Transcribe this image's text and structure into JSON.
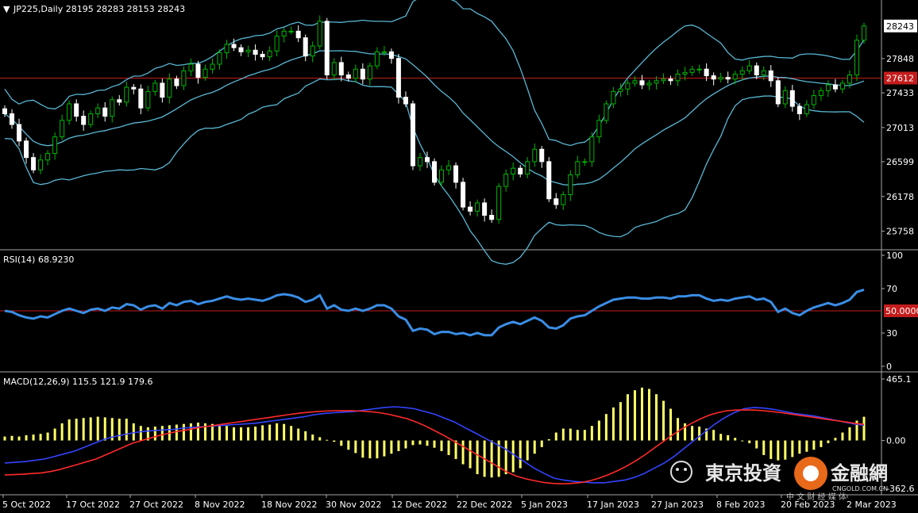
{
  "panels": {
    "main": {
      "header": "JP225,Daily  28195 28283 28153 28243",
      "current_price_label": "28243",
      "red_line_label": "27612",
      "axis_ticks": [
        "27848",
        "27433",
        "27013",
        "26599",
        "26178",
        "25758"
      ]
    },
    "rsi": {
      "header": "RSI(14) 68.9230",
      "axis_ticks": [
        "100",
        "70",
        "50.0000",
        "30",
        "0"
      ]
    },
    "macd": {
      "header": "MACD(12,26,9) 115.5 121.9 179.6",
      "axis_ticks": [
        "465.1",
        "0.00",
        "-362.6"
      ]
    },
    "x_labels": [
      "5 Oct 2022",
      "17 Oct 2022",
      "27 Oct 2022",
      "8 Nov 2022",
      "18 Nov 2022",
      "30 Nov 2022",
      "12 Dec 2022",
      "22 Dec 2022",
      "5 Jan 2023",
      "17 Jan 2023",
      "27 Jan 2023",
      "8 Feb 2023",
      "20 Feb 2023",
      "2 Mar 2023"
    ]
  },
  "watermark": {
    "text": "東京投資",
    "text2": "金融網",
    "small": "CNGOLD.COM.CN",
    "sub": "中 文 财 经 媒 体"
  },
  "colors": {
    "bull": "#00b800",
    "bear": "#ffffff",
    "bands": "#59b7d4",
    "rsi": "#3a8ee6",
    "macd_hist": "#ffff66",
    "macd_line": "#3344ff",
    "signal_line": "#ff2a2a",
    "ref_line": "#c41c1c"
  },
  "chart_data": {
    "type": "candlestick",
    "close": [
      27180,
      27050,
      26850,
      26650,
      26500,
      26620,
      26700,
      26900,
      27100,
      27300,
      27150,
      27050,
      27180,
      27250,
      27150,
      27350,
      27320,
      27500,
      27480,
      27250,
      27450,
      27550,
      27380,
      27600,
      27520,
      27700,
      27780,
      27620,
      27720,
      27780,
      27920,
      28020,
      27980,
      27930,
      27950,
      27900,
      27870,
      27940,
      28120,
      28180,
      28180,
      28100,
      27880,
      28000,
      28300,
      27650,
      27800,
      27650,
      27610,
      27720,
      27600,
      27760,
      27930,
      27930,
      27850,
      27380,
      27300,
      26550,
      26650,
      26600,
      26350,
      26500,
      26550,
      26350,
      26050,
      26000,
      26100,
      25950,
      25900,
      26300,
      26450,
      26520,
      26450,
      26600,
      26750,
      26600,
      26150,
      26080,
      26200,
      26440,
      26600,
      26600,
      26900,
      27100,
      27300,
      27450,
      27480,
      27550,
      27580,
      27530,
      27550,
      27580,
      27600,
      27580,
      27660,
      27680,
      27720,
      27720,
      27640,
      27600,
      27620,
      27600,
      27660,
      27700,
      27760,
      27650,
      27700,
      27580,
      27300,
      27460,
      27270,
      27180,
      27290,
      27400,
      27460,
      27530,
      27480,
      27550,
      27650,
      28070,
      28243
    ],
    "rsi": [
      50,
      49,
      46,
      44,
      43,
      45,
      44,
      47,
      50,
      52,
      50,
      48,
      51,
      52,
      50,
      53,
      52,
      56,
      55,
      51,
      54,
      55,
      52,
      57,
      55,
      58,
      59,
      56,
      58,
      59,
      61,
      63,
      61,
      60,
      61,
      60,
      59,
      61,
      64,
      65,
      64,
      62,
      58,
      60,
      64,
      52,
      55,
      51,
      50,
      52,
      50,
      52,
      55,
      55,
      52,
      45,
      42,
      32,
      34,
      33,
      29,
      31,
      31,
      29,
      30,
      28,
      30,
      28,
      28,
      35,
      38,
      40,
      38,
      41,
      44,
      41,
      35,
      34,
      37,
      43,
      45,
      46,
      50,
      54,
      57,
      60,
      61,
      62,
      62,
      61,
      61,
      62,
      62,
      61,
      63,
      63,
      64,
      64,
      61,
      59,
      60,
      59,
      61,
      62,
      63,
      60,
      61,
      58,
      49,
      52,
      48,
      46,
      50,
      53,
      55,
      57,
      55,
      57,
      60,
      67,
      69
    ],
    "macd": {
      "histogram": [
        30,
        35,
        30,
        40,
        45,
        50,
        60,
        90,
        130,
        160,
        165,
        170,
        175,
        180,
        175,
        170,
        165,
        165,
        130,
        110,
        100,
        105,
        110,
        115,
        120,
        125,
        130,
        135,
        130,
        125,
        120,
        110,
        100,
        100,
        100,
        105,
        115,
        120,
        130,
        125,
        110,
        90,
        70,
        45,
        25,
        5,
        -10,
        -40,
        -70,
        -95,
        -130,
        -135,
        -135,
        -120,
        -100,
        -80,
        -60,
        -35,
        -30,
        -40,
        -55,
        -80,
        -110,
        -140,
        -180,
        -210,
        -255,
        -275,
        -280,
        -275,
        -255,
        -240,
        -210,
        -150,
        -100,
        -50,
        10,
        60,
        90,
        90,
        80,
        80,
        110,
        150,
        200,
        250,
        290,
        350,
        380,
        400,
        390,
        350,
        300,
        240,
        170,
        130,
        110,
        105,
        90,
        80,
        50,
        40,
        20,
        0,
        -20,
        -60,
        -110,
        -140,
        -150,
        -145,
        -125,
        -100,
        -85,
        -70,
        -50,
        -20,
        20,
        60,
        100,
        150,
        179.6
      ],
      "macd": [
        -170,
        -165,
        -160,
        -150,
        -140,
        -120,
        -100,
        -80,
        -50,
        -20,
        10,
        30,
        45,
        60,
        70,
        75,
        80,
        85,
        95,
        100,
        105,
        110,
        115,
        120,
        125,
        130,
        140,
        150,
        160,
        170,
        180,
        195,
        205,
        210,
        215,
        220,
        230,
        240,
        250,
        255,
        250,
        240,
        220,
        200,
        170,
        140,
        100,
        60,
        20,
        -20,
        -60,
        -110,
        -160,
        -210,
        -250,
        -285,
        -300,
        -310,
        -315,
        -320,
        -320,
        -310,
        -300,
        -280,
        -250,
        -210,
        -170,
        -120,
        -60,
        0,
        60,
        120,
        170,
        210,
        240,
        250,
        245,
        235,
        220,
        205,
        195,
        185,
        170,
        155,
        140,
        125,
        115.5
      ],
      "signal": [
        -260,
        -258,
        -255,
        -250,
        -245,
        -235,
        -220,
        -200,
        -180,
        -160,
        -140,
        -110,
        -80,
        -50,
        -20,
        0,
        20,
        40,
        55,
        70,
        80,
        95,
        105,
        115,
        125,
        135,
        145,
        155,
        165,
        175,
        185,
        195,
        205,
        212,
        218,
        222,
        225,
        226,
        225,
        222,
        218,
        210,
        198,
        182,
        165,
        140,
        110,
        75,
        40,
        0,
        -40,
        -80,
        -120,
        -160,
        -200,
        -240,
        -270,
        -290,
        -305,
        -318,
        -325,
        -328,
        -325,
        -318,
        -305,
        -285,
        -260,
        -230,
        -195,
        -155,
        -110,
        -60,
        -10,
        40,
        85,
        125,
        160,
        190,
        210,
        225,
        230,
        232,
        230,
        225,
        218,
        210,
        200,
        190,
        180,
        170,
        160,
        150,
        140,
        130,
        121.9
      ]
    }
  }
}
